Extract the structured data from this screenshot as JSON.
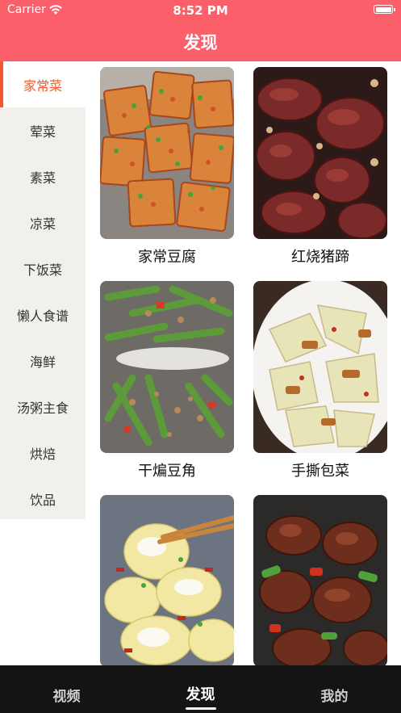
{
  "status_bar": {
    "carrier": "Carrier",
    "time": "8:52 PM"
  },
  "nav": {
    "title": "发现"
  },
  "sidebar": {
    "items": [
      {
        "label": "家常菜",
        "active": true
      },
      {
        "label": "荤菜"
      },
      {
        "label": "素菜"
      },
      {
        "label": "凉菜"
      },
      {
        "label": "下饭菜"
      },
      {
        "label": "懒人食谱"
      },
      {
        "label": "海鲜"
      },
      {
        "label": "汤粥主食"
      },
      {
        "label": "烘焙"
      },
      {
        "label": "饮品"
      }
    ]
  },
  "recipes": [
    {
      "title": "家常豆腐",
      "image": "braised-tofu-photo"
    },
    {
      "title": "红烧猪蹄",
      "image": "braised-pork-trotters-photo"
    },
    {
      "title": "干煸豆角",
      "image": "dry-fried-green-beans-photo"
    },
    {
      "title": "手撕包菜",
      "image": "hand-torn-cabbage-photo"
    },
    {
      "title": "",
      "image": "napa-cabbage-stir-fry-photo"
    },
    {
      "title": "",
      "image": "braised-meat-with-peppers-photo"
    }
  ],
  "tab_bar": {
    "tabs": [
      {
        "label": "视频"
      },
      {
        "label": "发现",
        "active": true
      },
      {
        "label": "我的"
      }
    ]
  },
  "colors": {
    "brand": "#fa5f6a",
    "accent": "#f0592c",
    "sidebar_bg": "#f1f0ec",
    "tab_bar_bg": "#141414"
  }
}
